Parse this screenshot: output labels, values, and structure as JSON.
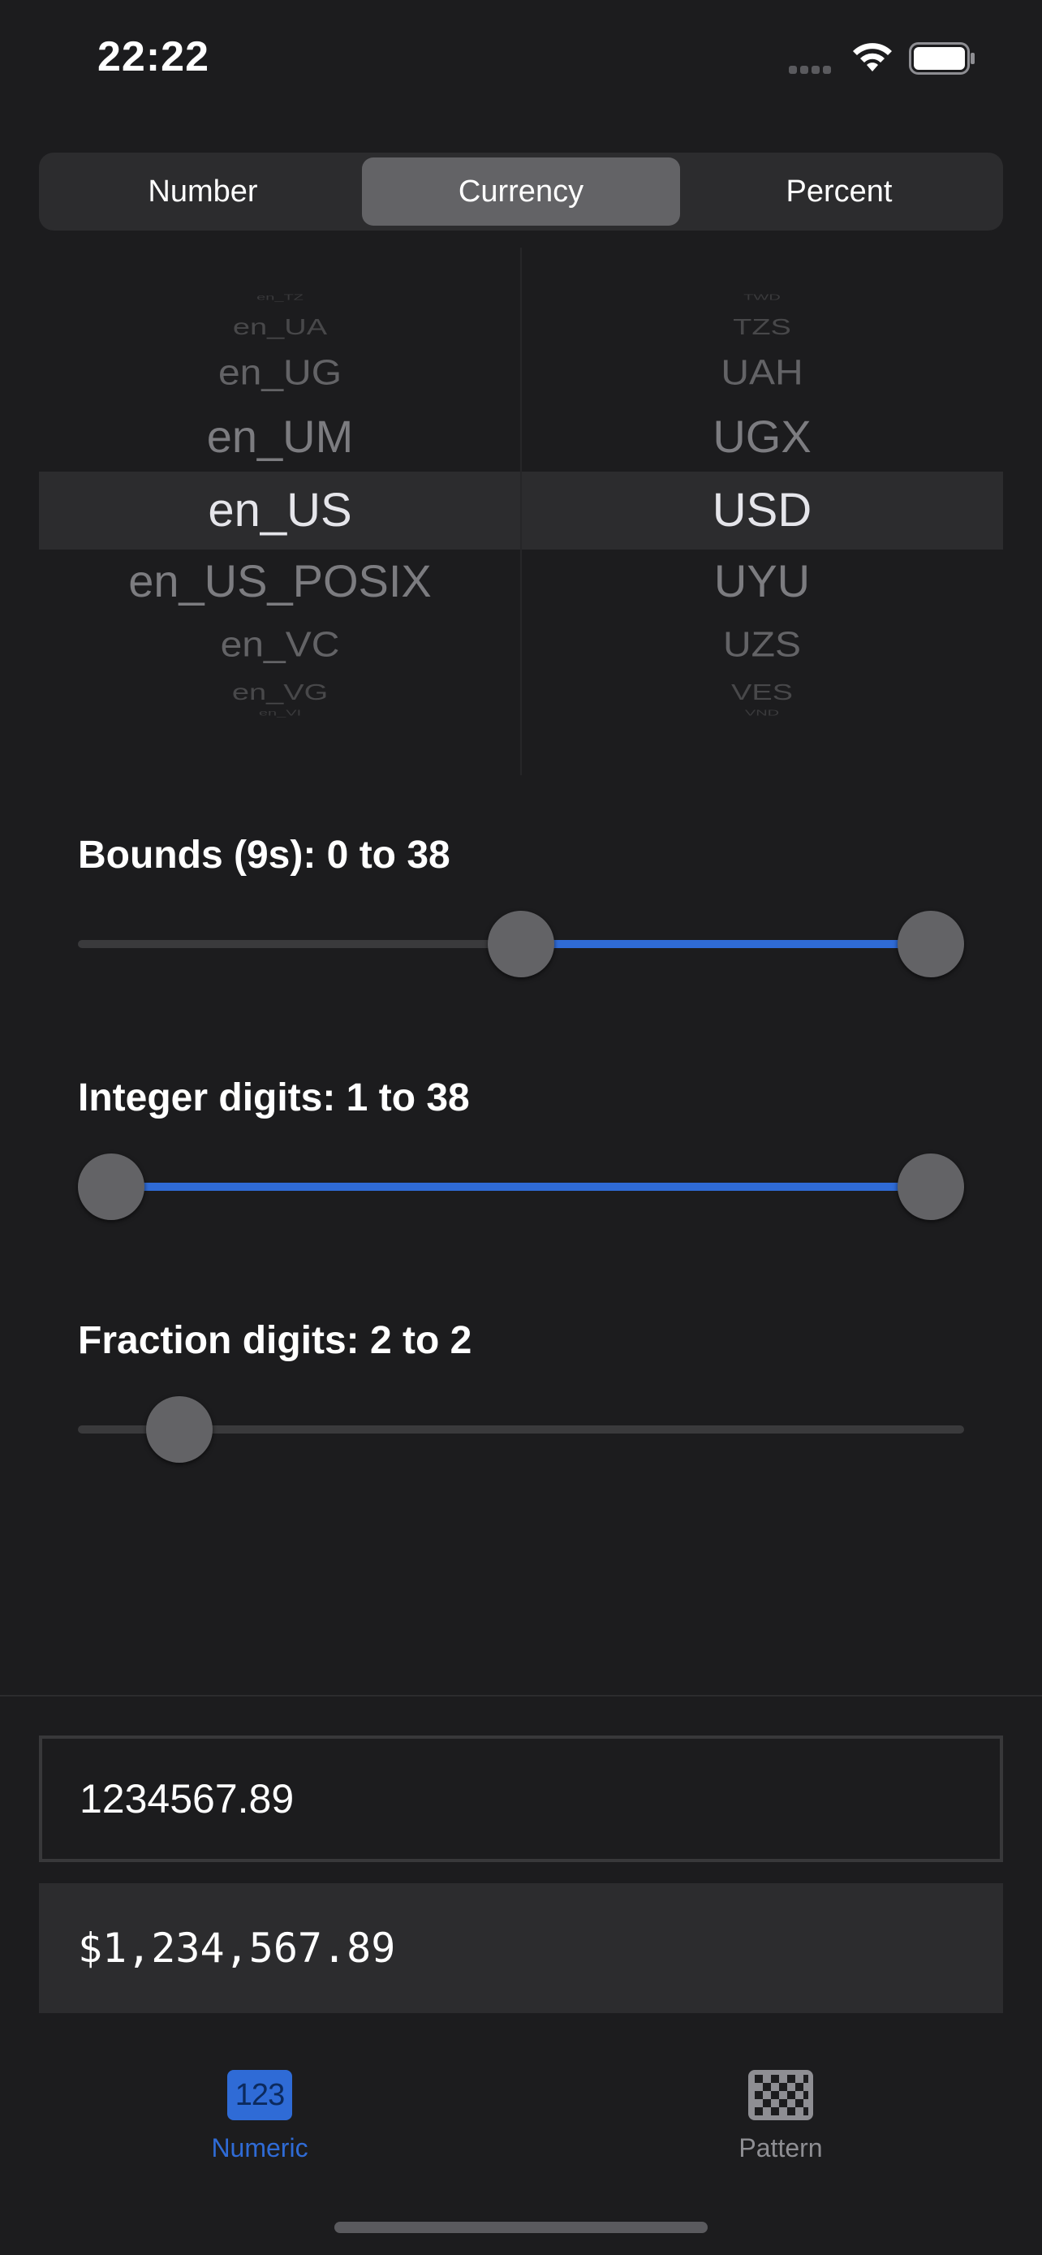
{
  "status_bar": {
    "time": "22:22"
  },
  "segmented_control": {
    "options": [
      "Number",
      "Currency",
      "Percent"
    ],
    "selected": "Currency"
  },
  "picker": {
    "locales": [
      "en_TZ",
      "en_UA",
      "en_UG",
      "en_UM",
      "en_US",
      "en_US_POSIX",
      "en_VC",
      "en_VG",
      "en_VI"
    ],
    "currencies": [
      "TWD",
      "TZS",
      "UAH",
      "UGX",
      "USD",
      "UYU",
      "UZS",
      "VES",
      "VND"
    ],
    "selected_locale": "en_US",
    "selected_currency": "USD"
  },
  "sliders": {
    "bounds": {
      "label": "Bounds (9s): 0 to 38",
      "lower_fraction": 0.5,
      "upper_fraction": 1.0
    },
    "integer_digits": {
      "label": "Integer digits: 1 to 38",
      "lower_fraction": 0.0,
      "upper_fraction": 1.0
    },
    "fraction_digits": {
      "label": "Fraction digits: 2 to 2",
      "value_fraction": 0.083
    }
  },
  "input": {
    "value": "1234567.89"
  },
  "output": {
    "value": "$1,234,567.89"
  },
  "tab_bar": {
    "numeric": {
      "label": "Numeric",
      "icon_text": "123"
    },
    "pattern": {
      "label": "Pattern"
    },
    "active": "Numeric"
  },
  "colors": {
    "accent": "#2f6bd6",
    "background": "#1c1c1e",
    "thumb": "#636366"
  }
}
